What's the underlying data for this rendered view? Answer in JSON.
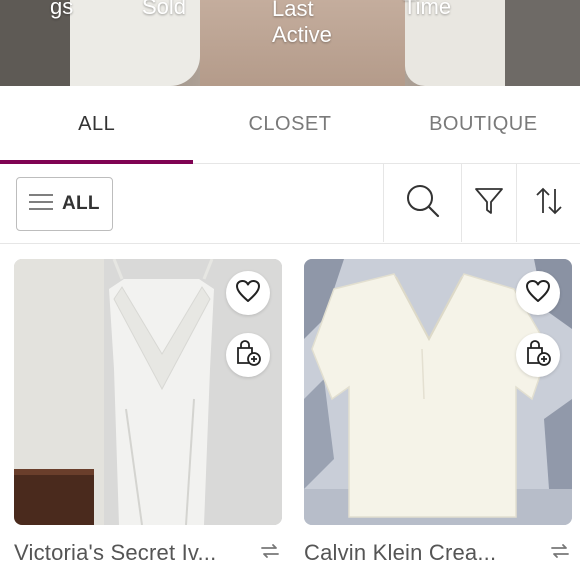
{
  "profile_stats": {
    "listings_fragment": "gs",
    "sold_label": "Sold",
    "last_active_label": "Last Active",
    "time_fragment": "Time"
  },
  "tabs": [
    {
      "label": "ALL",
      "active": true
    },
    {
      "label": "CLOSET",
      "active": false
    },
    {
      "label": "BOUTIQUE",
      "active": false
    }
  ],
  "filter_bar": {
    "all_label": "ALL",
    "icons": [
      "menu-icon",
      "search-icon",
      "filter-icon",
      "sort-icon"
    ]
  },
  "listings": [
    {
      "title": "Victoria's Secret Iv...",
      "icons": [
        "heart-icon",
        "shopping-bag-plus-icon",
        "share-icon"
      ]
    },
    {
      "title": "Calvin Klein Crea...",
      "icons": [
        "heart-icon",
        "shopping-bag-plus-icon",
        "share-icon"
      ]
    }
  ],
  "colors": {
    "accent": "#7f0353",
    "text": "#333333",
    "muted": "#7a7a7a",
    "divider": "#e6e6e6"
  }
}
